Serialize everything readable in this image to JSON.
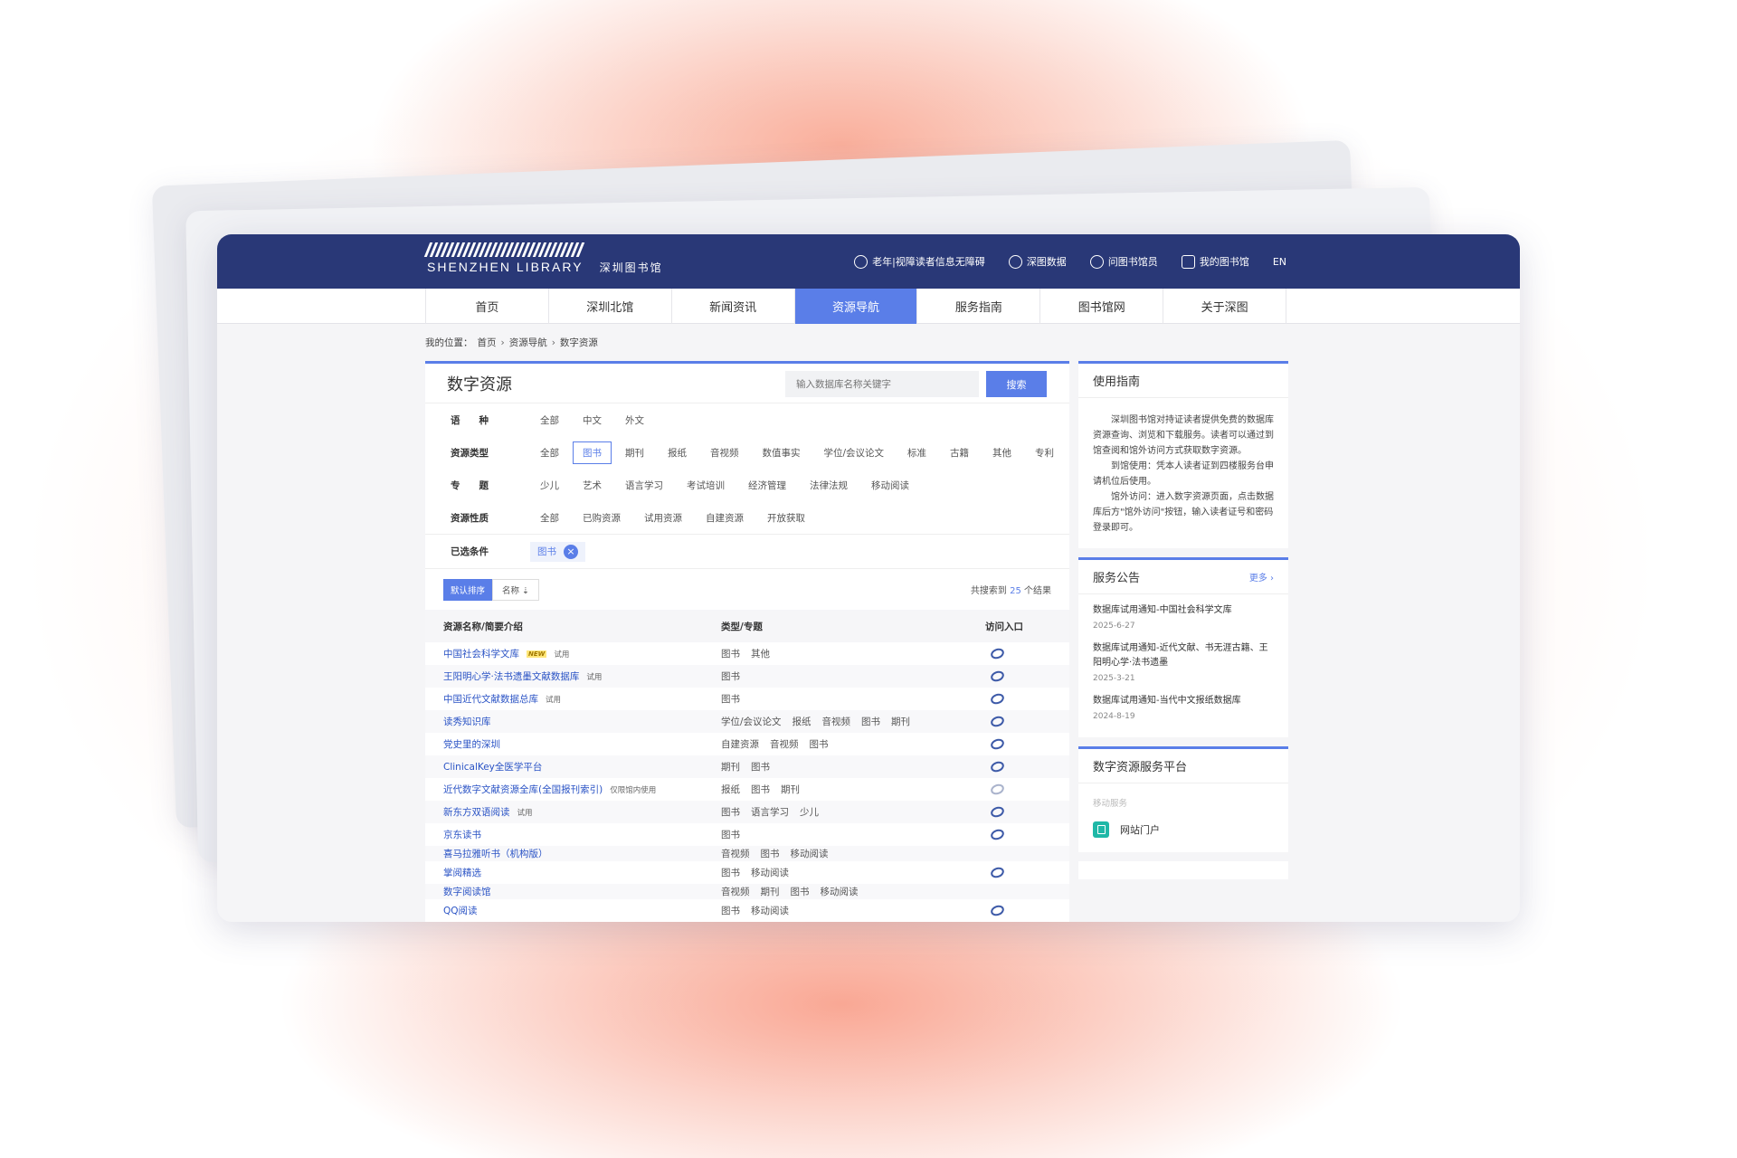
{
  "header": {
    "logo_en": "SHENZHEN LIBRARY",
    "logo_cn": "深圳图书馆",
    "links": [
      {
        "label": "老年|视障读者信息无障碍",
        "icon": "chat-bubble-icon"
      },
      {
        "label": "深图数据",
        "icon": "chart-search-icon"
      },
      {
        "label": "问图书馆员",
        "icon": "hand-question-icon"
      },
      {
        "label": "我的图书馆",
        "icon": "user-card-icon"
      },
      {
        "label": "EN",
        "icon": ""
      }
    ]
  },
  "nav": {
    "items": [
      "首页",
      "深圳北馆",
      "新闻资讯",
      "资源导航",
      "服务指南",
      "图书馆网",
      "关于深图"
    ],
    "active_index": 3
  },
  "breadcrumb": {
    "prefix": "我的位置：",
    "items": [
      "首页",
      "资源导航",
      "数字资源"
    ]
  },
  "main": {
    "title": "数字资源",
    "search_placeholder": "输入数据库名称关键字",
    "search_button": "搜索",
    "filters": [
      {
        "label": "语　　种",
        "options": [
          "全部",
          "中文",
          "外文"
        ],
        "selected": -1
      },
      {
        "label": "资源类型",
        "options": [
          "全部",
          "图书",
          "期刊",
          "报纸",
          "音视频",
          "数值事实",
          "学位/会议论文",
          "标准",
          "古籍",
          "其他",
          "专利"
        ],
        "selected": 1
      },
      {
        "label": "专　　题",
        "options": [
          "少儿",
          "艺术",
          "语言学习",
          "考试培训",
          "经济管理",
          "法律法规",
          "移动阅读"
        ],
        "selected": -1
      },
      {
        "label": "资源性质",
        "options": [
          "全部",
          "已购资源",
          "试用资源",
          "自建资源",
          "开放获取"
        ],
        "selected": -1
      }
    ],
    "selected_label": "已选条件",
    "selected_chip": "图书",
    "sort_default": "默认排序",
    "sort_name": "名称 ⇣",
    "results_prefix": "共搜索到",
    "results_count": "25",
    "results_suffix": "个结果",
    "table_headers": [
      "资源名称/简要介绍",
      "类型/专题",
      "访问入口"
    ],
    "rows": [
      {
        "name": "中国社会科学文库",
        "new": "NEW",
        "tag": "试用",
        "types": [
          "图书",
          "其他"
        ],
        "icon": "normal",
        "h": 25
      },
      {
        "name": "王阳明心学·法书遗墨文献数据库",
        "new": "",
        "tag": "试用",
        "types": [
          "图书"
        ],
        "icon": "normal",
        "h": 25
      },
      {
        "name": "中国近代文献数据总库",
        "new": "",
        "tag": "试用",
        "types": [
          "图书"
        ],
        "icon": "normal",
        "h": 25
      },
      {
        "name": "读秀知识库",
        "new": "",
        "tag": "",
        "types": [
          "学位/会议论文",
          "报纸",
          "音视频",
          "图书",
          "期刊"
        ],
        "icon": "normal",
        "h": 25
      },
      {
        "name": "党史里的深圳",
        "new": "",
        "tag": "",
        "types": [
          "自建资源",
          "音视频",
          "图书"
        ],
        "icon": "normal",
        "h": 25
      },
      {
        "name": "ClinicalKey全医学平台",
        "new": "",
        "tag": "",
        "types": [
          "期刊",
          "图书"
        ],
        "icon": "normal",
        "h": 25
      },
      {
        "name": "近代数字文献资源全库(全国报刊索引)",
        "new": "",
        "tag": "仅限馆内使用",
        "types": [
          "报纸",
          "图书",
          "期刊"
        ],
        "icon": "dim",
        "h": 25
      },
      {
        "name": "新东方双语阅读",
        "new": "",
        "tag": "试用",
        "types": [
          "图书",
          "语言学习",
          "少儿"
        ],
        "icon": "normal",
        "h": 25
      },
      {
        "name": "京东读书",
        "new": "",
        "tag": "",
        "types": [
          "图书"
        ],
        "icon": "normal",
        "h": 25
      },
      {
        "name": "喜马拉雅听书（机构版）",
        "new": "",
        "tag": "",
        "types": [
          "音视频",
          "图书",
          "移动阅读"
        ],
        "icon": "none",
        "h": 17
      },
      {
        "name": "掌阅精选",
        "new": "",
        "tag": "",
        "types": [
          "图书",
          "移动阅读"
        ],
        "icon": "normal",
        "h": 25
      },
      {
        "name": "数字阅读馆",
        "new": "",
        "tag": "",
        "types": [
          "音视频",
          "期刊",
          "图书",
          "移动阅读"
        ],
        "icon": "none",
        "h": 17
      },
      {
        "name": "QQ阅读",
        "new": "",
        "tag": "",
        "types": [
          "图书",
          "移动阅读"
        ],
        "icon": "normal",
        "h": 25
      }
    ]
  },
  "side": {
    "guide_title": "使用指南",
    "guide_paras": [
      "深圳图书馆对持证读者提供免费的数据库资源查询、浏览和下载服务。读者可以通过到馆查阅和馆外访问方式获取数字资源。",
      "到馆使用：凭本人读者证到四楼服务台申请机位后使用。",
      "馆外访问：进入数字资源页面，点击数据库后方\"馆外访问\"按钮，输入读者证号和密码登录即可。"
    ],
    "notice_title": "服务公告",
    "notice_more": "更多 ›",
    "notices": [
      {
        "title": "数据库试用通知-中国社会科学文库",
        "date": "2025-6-27"
      },
      {
        "title": "数据库试用通知-近代文献、书无涯古籍、王阳明心学·法书遗墨",
        "date": "2025-3-21"
      },
      {
        "title": "数据库试用通知-当代中文报纸数据库",
        "date": "2024-8-19"
      }
    ],
    "platform_title": "数字资源服务平台",
    "platform_sub": "移动服务",
    "portal_label": "网站门户"
  },
  "colors": {
    "header_bg": "#293877",
    "accent": "#5a7ee8",
    "link": "#2a53c5"
  }
}
